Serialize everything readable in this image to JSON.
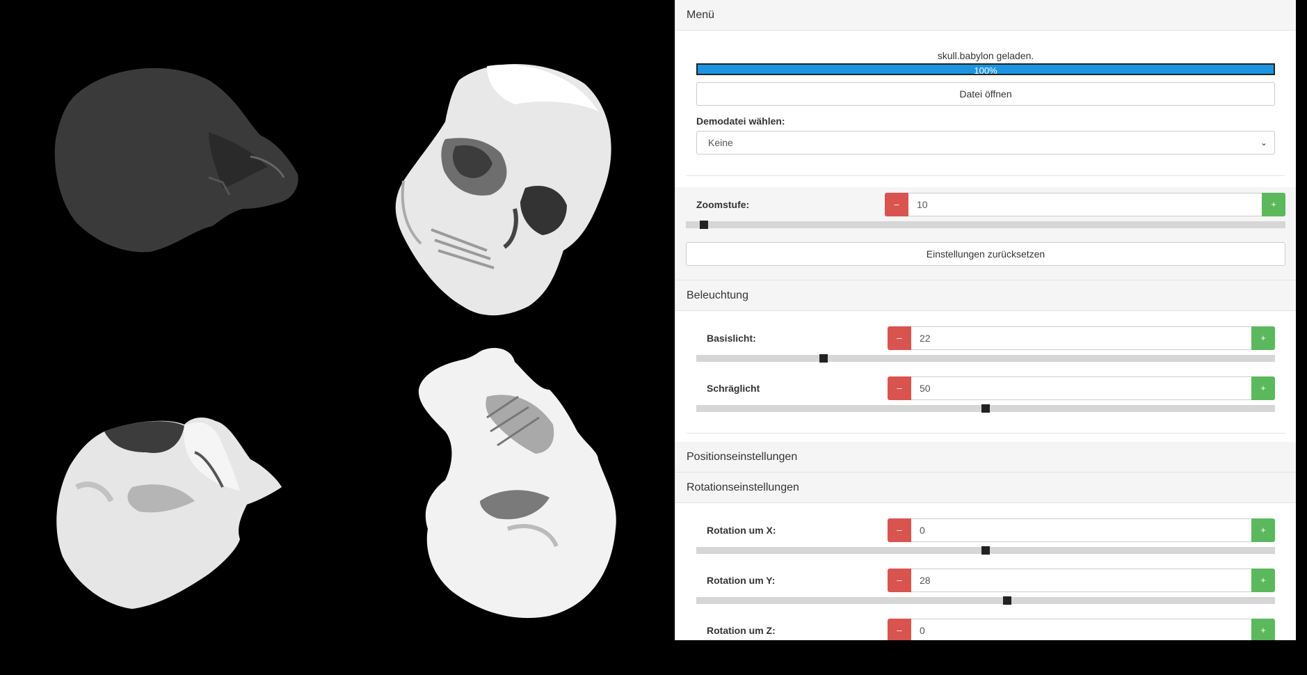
{
  "menu": {
    "title": "Menü",
    "status": "skull.babylon geladen.",
    "progress_label": "100%",
    "progress": 1.0,
    "open_file": "Datei öffnen",
    "demo_label": "Demodatei wählen:",
    "demo_value": "Keine",
    "zoom_label": "Zoomstufe:",
    "zoom_value": "10",
    "zoom_fraction": 0.03,
    "reset_label": "Einstellungen zurücksetzen"
  },
  "lighting": {
    "title": "Beleuchtung",
    "items": [
      {
        "label": "Basislicht:",
        "value": "22",
        "fraction": 0.22
      },
      {
        "label": "Schräglicht",
        "value": "50",
        "fraction": 0.5
      }
    ]
  },
  "position": {
    "title": "Positionseinstellungen"
  },
  "rotation": {
    "title": "Rotationseinstellungen",
    "items": [
      {
        "label": "Rotation um X:",
        "value": "0",
        "fraction": 0.5
      },
      {
        "label": "Rotation um Y:",
        "value": "28",
        "fraction": 0.537
      },
      {
        "label": "Rotation um Z:",
        "value": "0",
        "fraction": 0.5
      }
    ]
  },
  "buttons": {
    "minus": "–",
    "plus": "+"
  },
  "icons": {
    "select_caret": "chevron-down-icon"
  }
}
